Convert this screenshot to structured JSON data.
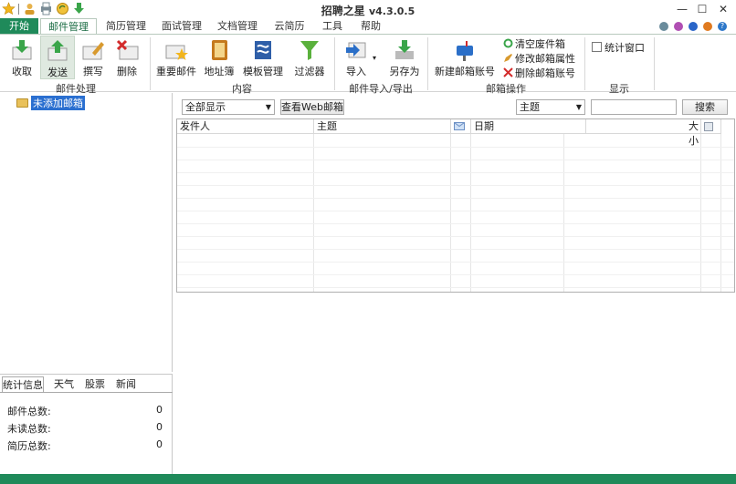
{
  "app": {
    "title": "招聘之星",
    "version": "v4.3.0.5"
  },
  "quick_access": [
    "star-icon",
    "user-icon",
    "print-icon",
    "refresh-icon",
    "download-icon"
  ],
  "window": {
    "minimize": "—",
    "maximize": "☐",
    "close": "✕"
  },
  "tabs": [
    {
      "label": "开始",
      "kind": "start"
    },
    {
      "label": "邮件管理",
      "active": true
    },
    {
      "label": "简历管理"
    },
    {
      "label": "面试管理"
    },
    {
      "label": "文档管理"
    },
    {
      "label": "云简历"
    },
    {
      "label": "工具"
    },
    {
      "label": "帮助"
    }
  ],
  "skin_colors": [
    "#6a8c9c",
    "#b04fb3",
    "#2a65c8",
    "#e07a1f"
  ],
  "ribbon": {
    "mail_process": {
      "label": "邮件处理",
      "buttons": [
        {
          "label": "收取",
          "icon": "receive-mail-icon"
        },
        {
          "label": "发送",
          "icon": "send-mail-icon",
          "selected": true
        },
        {
          "label": "撰写",
          "icon": "compose-mail-icon"
        },
        {
          "label": "删除",
          "icon": "delete-mail-icon"
        }
      ]
    },
    "content": {
      "label": "内容",
      "buttons": [
        {
          "label": "重要邮件",
          "icon": "important-mail-icon"
        },
        {
          "label": "地址簿",
          "icon": "address-book-icon"
        },
        {
          "label": "模板管理",
          "icon": "template-icon"
        },
        {
          "label": "过滤器",
          "icon": "filter-icon"
        }
      ]
    },
    "import_export": {
      "label": "邮件导入/导出",
      "buttons": [
        {
          "label": "导入",
          "icon": "import-icon"
        },
        {
          "label": "另存为",
          "icon": "save-as-icon"
        }
      ]
    },
    "mailbox_ops": {
      "label": "邮箱操作",
      "new_account": "新建邮箱账号",
      "clear_trash": "清空废件箱",
      "edit_props": "修改邮箱属性",
      "delete_account": "删除邮箱账号"
    },
    "display": {
      "label": "显示",
      "stats_window": "统计窗口"
    }
  },
  "tree": {
    "root_label": "未添加邮箱"
  },
  "filter": {
    "selected": "全部显示",
    "web_button": "查看Web邮箱",
    "field_selected": "主题",
    "search_value": "",
    "search_button": "搜索"
  },
  "grid": {
    "columns": [
      "发件人",
      "主题",
      "",
      "日期",
      "大小",
      ""
    ]
  },
  "bottom_tabs": [
    "统计信息",
    "天气",
    "股票",
    "新闻"
  ],
  "stats": [
    {
      "label": "邮件总数:",
      "value": "0"
    },
    {
      "label": "未读总数:",
      "value": "0"
    },
    {
      "label": "简历总数:",
      "value": "0"
    }
  ]
}
